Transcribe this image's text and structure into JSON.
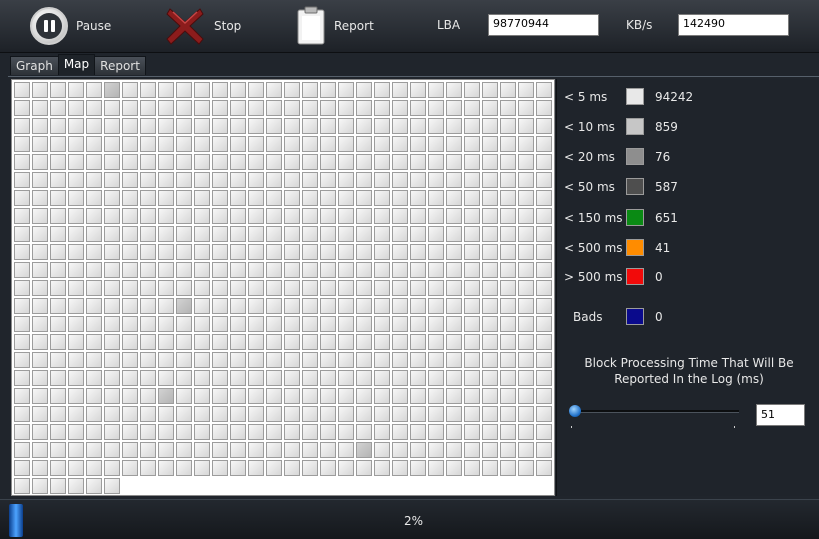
{
  "toolbar": {
    "pause_label": "Pause",
    "stop_label": "Stop",
    "report_label": "Report",
    "lba_label": "LBA",
    "lba_value": "98770944",
    "kbs_label": "KB/s",
    "kbs_value": "142490"
  },
  "tabs": [
    {
      "label": "Graph",
      "active": false
    },
    {
      "label": "Map",
      "active": true
    },
    {
      "label": "Report",
      "active": false
    }
  ],
  "map": {
    "columns": 30,
    "full_rows": 22,
    "last_row_cells": 6,
    "darker_cells": [
      5,
      369,
      518,
      619
    ]
  },
  "legend": [
    {
      "label": "< 5 ms",
      "color": "#e8e8e8",
      "count": "94242"
    },
    {
      "label": "< 10 ms",
      "color": "#c6c6c6",
      "count": "859"
    },
    {
      "label": "< 20 ms",
      "color": "#8e8e8e",
      "count": "76"
    },
    {
      "label": "< 50 ms",
      "color": "#4e4e4e",
      "count": "587"
    },
    {
      "label": "< 150 ms",
      "color": "#0a8a14",
      "count": "651"
    },
    {
      "label": "< 500 ms",
      "color": "#ff8c00",
      "count": "41"
    },
    {
      "label": "> 500 ms",
      "color": "#f20a0a",
      "count": "0"
    },
    {
      "label": "Bads",
      "color": "#0a0a8c",
      "count": "0"
    }
  ],
  "block_title": "Block Processing Time That Will Be Reported In the Log (ms)",
  "slider": {
    "value": "51"
  },
  "status": {
    "progress_text": "2%",
    "progress": 0.02
  }
}
